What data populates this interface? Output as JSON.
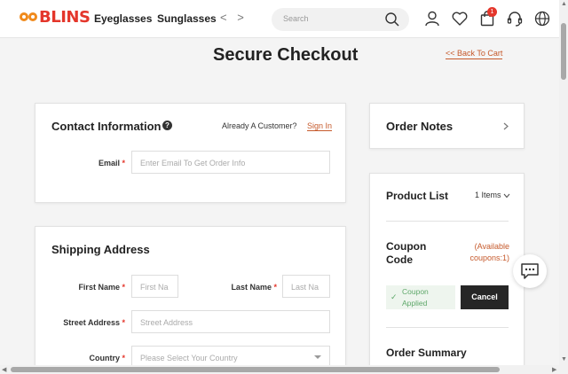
{
  "header": {
    "logo_text": "BLINS",
    "nav": [
      "Eyeglasses",
      "Sunglasses"
    ],
    "nav_arrows": "< >",
    "search_placeholder": "Search",
    "cart_count": "1"
  },
  "page": {
    "title": "Secure Checkout",
    "back_link": "<< Back To Cart"
  },
  "contact": {
    "heading": "Contact Information",
    "help_glyph": "?",
    "already_customer": "Already A Customer?",
    "sign_in": "Sign In",
    "email_label": "Email",
    "email_placeholder": "Enter Email To Get Order Info"
  },
  "shipping": {
    "heading": "Shipping Address",
    "first_name_label": "First Name",
    "first_name_placeholder": "First Na",
    "last_name_label": "Last Name",
    "last_name_placeholder": "Last Na",
    "street_label": "Street Address",
    "street_placeholder": "Street Address",
    "country_label": "Country",
    "country_placeholder": "Please Select Your Country"
  },
  "required_mark": "*",
  "order_notes": {
    "heading": "Order Notes"
  },
  "product_list": {
    "heading": "Product List",
    "items_count": "1 Items",
    "coupon_title": "Coupon Code",
    "coupon_available": "(Available coupons:1)",
    "coupon_applied": "Coupon Applied",
    "cancel_label": "Cancel",
    "order_summary": "Order Summary"
  },
  "colors": {
    "brand": "#e4362b",
    "accent_link": "#c65a2c",
    "success": "#5fa86a"
  },
  "icons": [
    "search-icon",
    "user-icon",
    "heart-icon",
    "cart-icon",
    "headset-icon",
    "globe-icon",
    "help-icon",
    "chevron-right-icon",
    "chevron-down-icon",
    "check-icon",
    "chat-icon"
  ]
}
